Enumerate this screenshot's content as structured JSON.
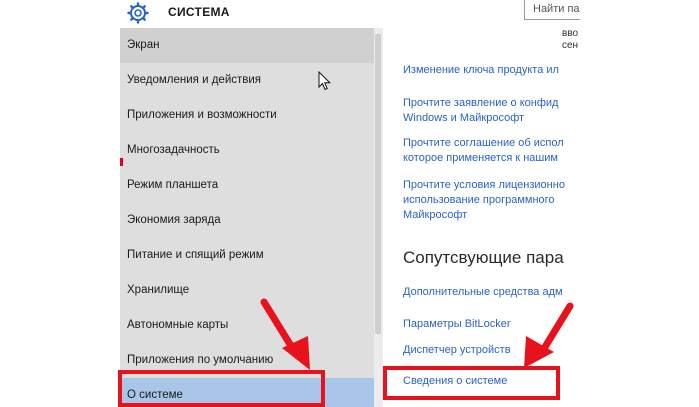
{
  "header": {
    "title": "СИСТЕМА",
    "search_placeholder": "Найти пар",
    "icon": "gear-icon"
  },
  "sidebar": {
    "items": [
      {
        "label": "Экран"
      },
      {
        "label": "Уведомления и действия"
      },
      {
        "label": "Приложения и возможности"
      },
      {
        "label": "Многозадачность"
      },
      {
        "label": "Режим планшета"
      },
      {
        "label": "Экономия заряда"
      },
      {
        "label": "Питание и спящий режим"
      },
      {
        "label": "Хранилище"
      },
      {
        "label": "Автономные карты"
      },
      {
        "label": "Приложения по умолчанию"
      },
      {
        "label": "О системе"
      }
    ]
  },
  "content": {
    "truncated_top": [
      "вво",
      "сен"
    ],
    "links_top": [
      {
        "lines": [
          "Изменение ключа продукта ил"
        ]
      },
      {
        "lines": [
          "Прочтите заявление о конфид",
          "Windows и Майкрософт"
        ]
      },
      {
        "lines": [
          "Прочтите соглашение об испол",
          "которое применяется к нашим"
        ]
      },
      {
        "lines": [
          "Прочтите условия лицензионно",
          "использование программного",
          "Майкрософт"
        ]
      }
    ],
    "related_title": "Сопутсвующие пара",
    "related_links": [
      {
        "label": "Дополнительные средства адм"
      },
      {
        "label": "Параметры BitLocker"
      },
      {
        "label": "Диспетчер устройств"
      },
      {
        "label": "Сведения о системе"
      }
    ]
  },
  "colors": {
    "accent": "#2a63c6",
    "selected": "#a9c6e8",
    "sidebar": "#dedede",
    "annotation": "#e8121d"
  }
}
